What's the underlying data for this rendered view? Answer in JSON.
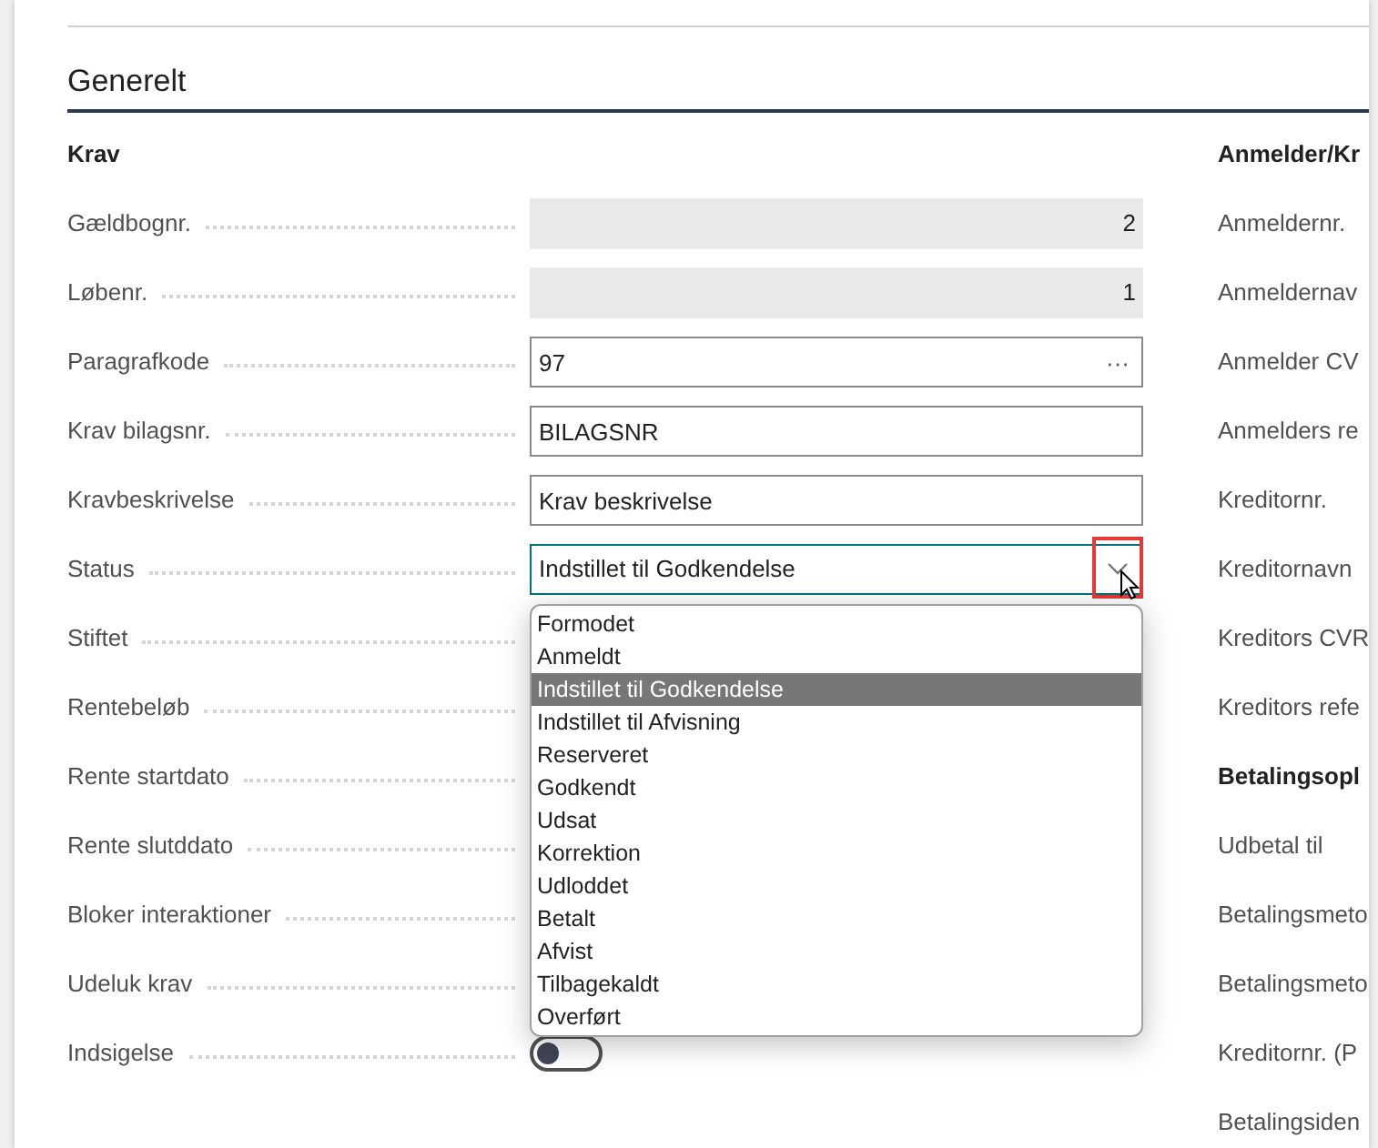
{
  "section": {
    "title": "Generelt"
  },
  "left_group": {
    "title": "Krav",
    "fields": [
      {
        "label": "Gældbognr.",
        "kind": "readonly",
        "value": "2"
      },
      {
        "label": "Løbenr.",
        "kind": "readonly",
        "value": "1"
      },
      {
        "label": "Paragrafkode",
        "kind": "lookup",
        "value": "97",
        "button": "···"
      },
      {
        "label": "Krav bilagsnr.",
        "kind": "text",
        "value": "BILAGSNR"
      },
      {
        "label": "Kravbeskrivelse",
        "kind": "text",
        "value": "Krav beskrivelse"
      },
      {
        "label": "Status",
        "kind": "select",
        "value": "Indstillet til Godkendelse",
        "expanded": true,
        "options": [
          {
            "label": "Formodet",
            "selected": false
          },
          {
            "label": "Anmeldt",
            "selected": false
          },
          {
            "label": "Indstillet til Godkendelse",
            "selected": true
          },
          {
            "label": "Indstillet til Afvisning",
            "selected": false
          },
          {
            "label": "Reserveret",
            "selected": false
          },
          {
            "label": "Godkendt",
            "selected": false
          },
          {
            "label": "Udsat",
            "selected": false
          },
          {
            "label": "Korrektion",
            "selected": false
          },
          {
            "label": "Udloddet",
            "selected": false
          },
          {
            "label": "Betalt",
            "selected": false
          },
          {
            "label": "Afvist",
            "selected": false
          },
          {
            "label": "Tilbagekaldt",
            "selected": false
          },
          {
            "label": "Overført",
            "selected": false
          }
        ]
      },
      {
        "label": "Stiftet",
        "kind": "covered"
      },
      {
        "label": "Rentebeløb",
        "kind": "covered"
      },
      {
        "label": "Rente startdato",
        "kind": "covered"
      },
      {
        "label": "Rente slutddato",
        "kind": "covered"
      },
      {
        "label": "Bloker interaktioner",
        "kind": "covered"
      },
      {
        "label": "Udeluk krav",
        "kind": "covered"
      },
      {
        "label": "Indsigelse",
        "kind": "toggle",
        "on": false
      }
    ]
  },
  "right_groups": [
    {
      "title": "Anmelder/Kr",
      "labels": [
        "Anmeldernr.",
        "Anmeldernav",
        "Anmelder CV",
        "Anmelders re",
        "Kreditornr.",
        "Kreditornavn",
        "Kreditors CVR",
        "Kreditors refe"
      ]
    },
    {
      "title": "Betalingsopl",
      "labels": [
        "Udbetal til",
        "Betalingsmeto",
        "Betalingsmeto",
        "Kreditornr. (P",
        "Betalingsiden"
      ]
    }
  ]
}
